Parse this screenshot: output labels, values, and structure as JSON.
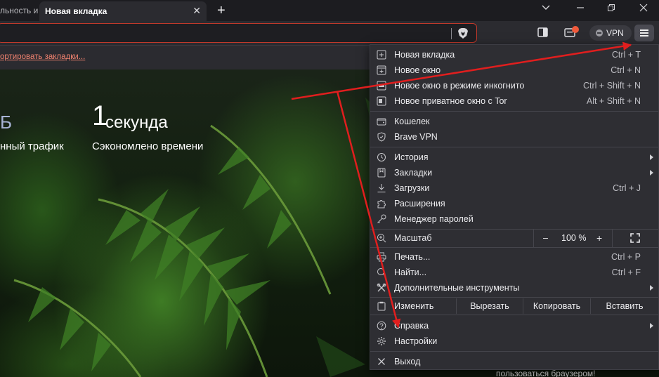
{
  "tabs": {
    "previous_tab_title": "льность и",
    "active_tab_title": "Новая вкладка",
    "new_tab_symbol": "+"
  },
  "window_controls": {
    "dropdown": "⌄",
    "minimize": "—",
    "restore": "❐",
    "close": "✕"
  },
  "toolbar": {
    "vpn_label": "VPN"
  },
  "bookmarks_bar": {
    "import_link": "ортировать закладки..."
  },
  "ntp": {
    "stat_left_value": "Б",
    "stat_left_label": "нный трафик",
    "time_number": "1",
    "time_unit": "секунда",
    "time_label": "Сэкономлено времени",
    "bottom_text": "пользоваться браузером!"
  },
  "menu": {
    "new_tab": {
      "label": "Новая вкладка",
      "shortcut": "Ctrl + T",
      "icon": "new-tab-icon"
    },
    "new_window": {
      "label": "Новое окно",
      "shortcut": "Ctrl + N",
      "icon": "new-window-icon"
    },
    "incognito": {
      "label": "Новое окно в режиме инкогнито",
      "shortcut": "Ctrl + Shift + N",
      "icon": "incognito-icon"
    },
    "tor": {
      "label": "Новое приватное окно с Tor",
      "shortcut": "Alt + Shift + N",
      "icon": "tor-icon"
    },
    "wallet": {
      "label": "Кошелек",
      "icon": "wallet-icon"
    },
    "vpn": {
      "label": "Brave VPN",
      "icon": "shield-icon"
    },
    "history": {
      "label": "История",
      "icon": "history-icon"
    },
    "bookmarks": {
      "label": "Закладки",
      "icon": "bookmark-icon"
    },
    "downloads": {
      "label": "Загрузки",
      "shortcut": "Ctrl + J",
      "icon": "download-icon"
    },
    "extensions": {
      "label": "Расширения",
      "icon": "puzzle-icon"
    },
    "passwords": {
      "label": "Менеджер паролей",
      "icon": "key-icon"
    },
    "zoom": {
      "label": "Масштаб",
      "minus": "–",
      "value": "100 %",
      "plus": "+",
      "icon": "zoom-icon"
    },
    "print": {
      "label": "Печать...",
      "shortcut": "Ctrl + P",
      "icon": "print-icon"
    },
    "find": {
      "label": "Найти...",
      "shortcut": "Ctrl + F",
      "icon": "search-icon"
    },
    "more_tools": {
      "label": "Дополнительные инструменты",
      "icon": "tools-icon"
    },
    "edit": {
      "label": "Изменить",
      "cut": "Вырезать",
      "copy": "Копировать",
      "paste": "Вставить",
      "icon": "clipboard-icon"
    },
    "help": {
      "label": "Справка",
      "icon": "help-icon"
    },
    "settings": {
      "label": "Настройки",
      "icon": "gear-icon"
    },
    "exit": {
      "label": "Выход",
      "icon": "close-icon"
    }
  },
  "colors": {
    "accent_red": "#e02020",
    "menu_bg": "#2e2e33",
    "toolbar_bg": "#2b2b30"
  }
}
